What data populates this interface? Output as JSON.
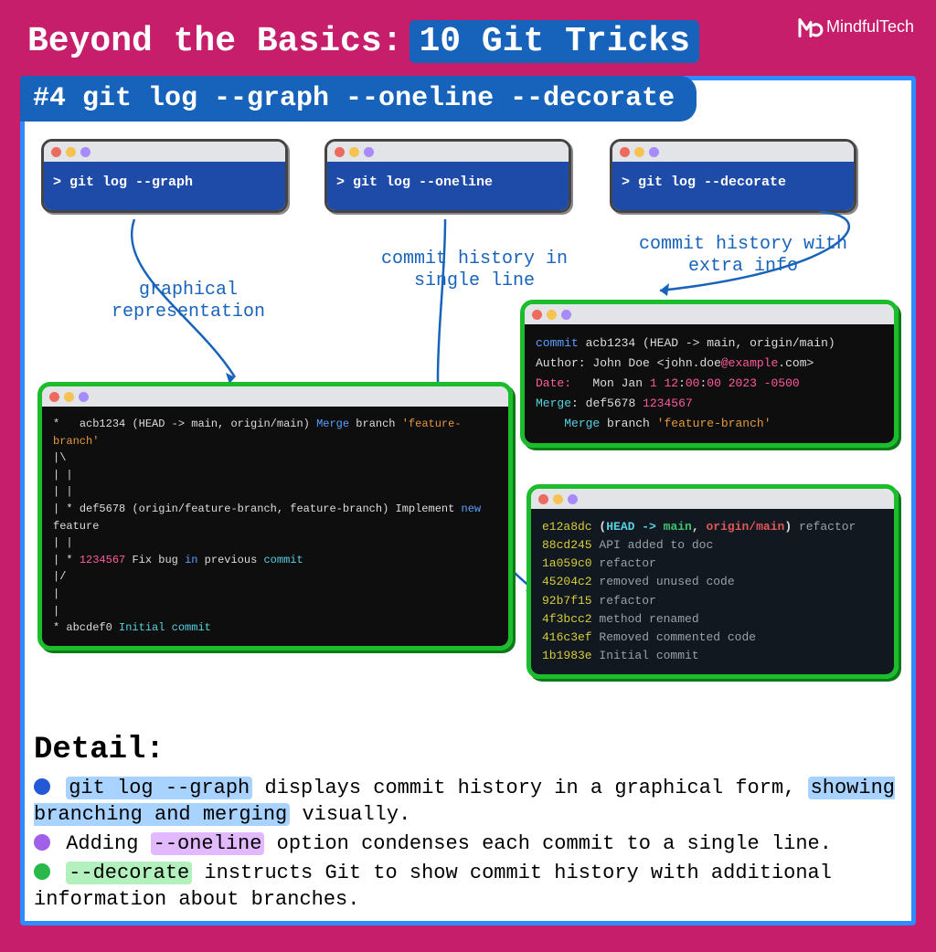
{
  "logo_text": "MindfulTech",
  "title_plain": "Beyond the Basics:",
  "title_highlight": "10 Git Tricks",
  "subtitle": "#4 git log --graph --oneline --decorate",
  "cmd_windows": {
    "graph": "> git log --graph",
    "oneline": "> git log --oneline",
    "decorate": "> git log --decorate"
  },
  "annotations": {
    "graph": "graphical\nrepresentation",
    "oneline": "commit history in\nsingle line",
    "decorate": "commit history with\nextra info"
  },
  "graph_terminal": {
    "l1_hash": "acb1234",
    "l1_refs": "(HEAD -> main, origin/main)",
    "l1_merge": "Merge",
    "l1_branch": "branch",
    "l1_feat": "'feature-branch'",
    "l2_hash": "def5678",
    "l2_refs": "(origin/feature-branch, feature-branch)",
    "l2_msg1": "Implement",
    "l2_new": "new",
    "l2_msg2": "feature",
    "l3_hash": "1234567",
    "l3_msg1": "Fix bug",
    "l3_in": "in",
    "l3_msg2": "previous",
    "l3_commit": "commit",
    "l4_hash": "abcdef0",
    "l4_initial": "Initial",
    "l4_commit": "commit"
  },
  "decorate_terminal": {
    "commit_kw": "commit",
    "commit_hash": "acb1234",
    "commit_refs": "(HEAD -> main, origin/main)",
    "author_label": "Author:",
    "author_name": "John Doe",
    "author_email_pre": "<john.doe",
    "author_at": "@example",
    "author_email_post": ".com>",
    "date_label": "Date:",
    "date_val1": "Mon Jan",
    "date_num1": "1 12",
    "date_sep": ":",
    "date_num2": "00",
    "date_num3": "00",
    "date_year": "2023 -0500",
    "merge_label": "Merge",
    "merge_sep": ":",
    "merge_h1": "def5678",
    "merge_h2": "1234567",
    "msg_merge": "Merge",
    "msg_branch": "branch",
    "msg_feat": "'feature-branch'"
  },
  "oneline_terminal": [
    {
      "hash": "e12a8dc",
      "refs": "(HEAD -> main, origin/main)",
      "msg": "refactor",
      "has_refs": true
    },
    {
      "hash": "88cd245",
      "msg": "API added to doc"
    },
    {
      "hash": "1a059c0",
      "msg": "refactor"
    },
    {
      "hash": "45204c2",
      "msg": "removed unused code"
    },
    {
      "hash": "92b7f15",
      "msg": "refactor"
    },
    {
      "hash": "4f3bcc2",
      "msg": "method renamed"
    },
    {
      "hash": "416c3ef",
      "msg": "Removed commented code"
    },
    {
      "hash": "1b1983e",
      "msg": "Initial commit"
    }
  ],
  "detail": {
    "heading": "Detail:",
    "p1_cmd": "git log --graph",
    "p1_a": " displays commit history in a graphical form, ",
    "p1_hl": "showing branching and merging",
    "p1_b": " visually.",
    "p2_a": "Adding ",
    "p2_cmd": "--oneline",
    "p2_b": " option condenses each commit to a single line.",
    "p3_cmd": "--decorate",
    "p3_a": " instructs Git to show commit history with additional information about branches."
  }
}
